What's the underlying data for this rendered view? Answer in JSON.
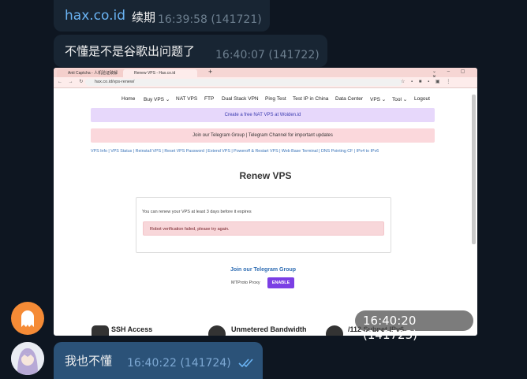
{
  "messages": [
    {
      "link": "hax.co.id",
      "text": "续期",
      "time": "16:39:58 (141721)"
    },
    {
      "text": "不懂是不是谷歌出问题了",
      "time": "16:40:07 (141722)"
    },
    {
      "time": "16:40:20 (141723)"
    },
    {
      "text": "我也不懂",
      "time": "16:40:22 (141724)"
    }
  ],
  "browser": {
    "tabs": [
      "Anti Captcha - 人机验证破解",
      "Renew VPS - Hax.co.id"
    ],
    "url": "hax.co.id/vps-renew/"
  },
  "site": {
    "nav": [
      "Home",
      "Buy VPS ⌄",
      "NAT VPS",
      "FTP",
      "Dual Stack VPN",
      "Ping Test",
      "Test IP in China",
      "Data Center",
      "VPS ⌄",
      "Tool ⌄",
      "Logout"
    ],
    "banner_purple": "Create a free NAT VPS at Woiden.id",
    "banner_pink": "Join our Telegram Group | Telegram Channel for important updates",
    "links": "VPS Info | VPS Status | Reinstall VPS | Reset VPS Password | Extend VPS | Poweroff & Restart VPS | Web Base Terminal | DNS Pointing CF | IPv4 to IPv6",
    "title": "Renew VPS",
    "card_note": "You can renew your VPS at least 3 days before it expires",
    "alert": "Robot verification failed, please try again.",
    "join": "Join our Telegram Group",
    "mtproto": "MTProto Proxy",
    "enable": "ENABLE",
    "features": [
      "SSH Access",
      "Unmetered Bandwidth",
      "/112 Subnet IPv6"
    ]
  },
  "colors": {
    "bg": "#0e1621",
    "bubble": "#182533",
    "outgoing": "#2b5278",
    "link": "#6ab3f3"
  }
}
